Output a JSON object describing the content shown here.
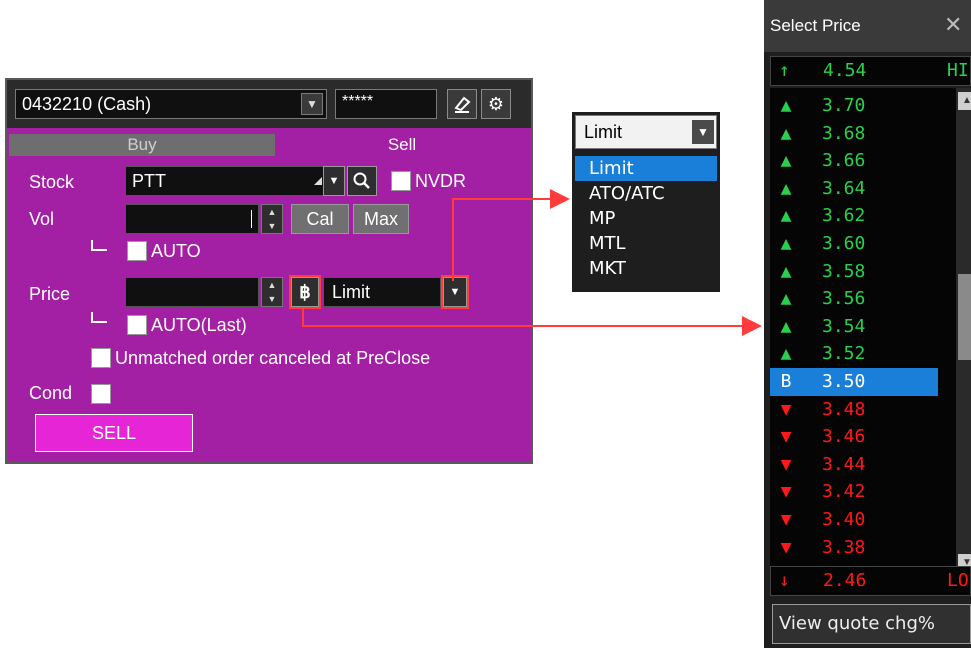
{
  "order_panel": {
    "account": "0432210 (Cash)",
    "pin_value": "*****",
    "tabs": {
      "buy": "Buy",
      "sell": "Sell"
    },
    "stock_label": "Stock",
    "stock_value": "PTT",
    "nvdr_label": "NVDR",
    "vol_label": "Vol",
    "cal_label": "Cal",
    "max_label": "Max",
    "auto_label": "AUTO",
    "price_label": "Price",
    "baht_symbol": "฿",
    "order_type_value": "Limit",
    "auto_last_label": "AUTO(Last)",
    "unmatched_label": "Unmatched order canceled at PreClose",
    "cond_label": "Cond",
    "sell_button": "SELL"
  },
  "order_type_dropdown": {
    "selected": "Limit",
    "options": [
      "Limit",
      "ATO/ATC",
      "MP",
      "MTL",
      "MKT"
    ]
  },
  "price_panel": {
    "title": "Select Price",
    "high": {
      "marker": "↑",
      "value": "4.54",
      "label": "HI"
    },
    "low": {
      "marker": "↓",
      "value": "2.46",
      "label": "LO"
    },
    "current_marker": "B",
    "rows": [
      {
        "marker": "▲",
        "value": "3.70",
        "dir": "up"
      },
      {
        "marker": "▲",
        "value": "3.68",
        "dir": "up"
      },
      {
        "marker": "▲",
        "value": "3.66",
        "dir": "up"
      },
      {
        "marker": "▲",
        "value": "3.64",
        "dir": "up"
      },
      {
        "marker": "▲",
        "value": "3.62",
        "dir": "up"
      },
      {
        "marker": "▲",
        "value": "3.60",
        "dir": "up"
      },
      {
        "marker": "▲",
        "value": "3.58",
        "dir": "up"
      },
      {
        "marker": "▲",
        "value": "3.56",
        "dir": "up"
      },
      {
        "marker": "▲",
        "value": "3.54",
        "dir": "up"
      },
      {
        "marker": "▲",
        "value": "3.52",
        "dir": "up"
      },
      {
        "marker": "B",
        "value": "3.50",
        "dir": "cur"
      },
      {
        "marker": "▼",
        "value": "3.48",
        "dir": "down"
      },
      {
        "marker": "▼",
        "value": "3.46",
        "dir": "down"
      },
      {
        "marker": "▼",
        "value": "3.44",
        "dir": "down"
      },
      {
        "marker": "▼",
        "value": "3.42",
        "dir": "down"
      },
      {
        "marker": "▼",
        "value": "3.40",
        "dir": "down"
      },
      {
        "marker": "▼",
        "value": "3.38",
        "dir": "down"
      }
    ],
    "view_quote": "View quote chg%"
  }
}
